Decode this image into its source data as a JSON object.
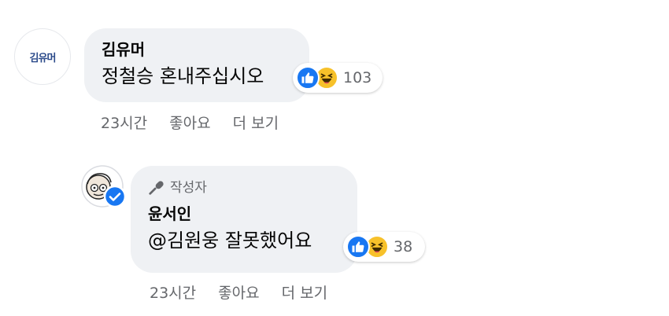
{
  "comment1": {
    "avatar_text": "김유머",
    "author": "김유머",
    "text": "정철승 혼내주십시오",
    "reaction_count": "103",
    "time": "23시간",
    "like_label": "좋아요",
    "more_label": "더 보기"
  },
  "comment2": {
    "badge": "작성자",
    "author": "윤서인",
    "text": "@김원웅 잘못했어요",
    "reaction_count": "38",
    "time": "23시간",
    "like_label": "좋아요",
    "more_label": "더 보기"
  },
  "colors": {
    "bubble": "#eff1f4",
    "like": "#1877f2",
    "haha": "#f7c12a",
    "meta": "#65676b"
  }
}
